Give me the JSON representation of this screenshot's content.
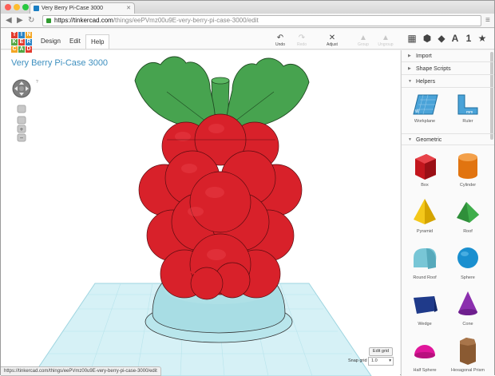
{
  "browser": {
    "tab_title": "Very Berry Pi-Case 3000",
    "url_host": "https://tinkercad.com",
    "url_path": "/things/eePVmz00u9E-very-berry-pi-case-3000/edit",
    "status_url": "https://tinkercad.com/things/eePVmz00u9E-very-berry-pi-case-3000/edit"
  },
  "logo": {
    "letters": [
      "T",
      "I",
      "N",
      "K",
      "E",
      "R",
      "C",
      "A",
      "D"
    ],
    "colors": [
      "#e23b2e",
      "#2a84c6",
      "#f4a623",
      "#55a845",
      "#e23b2e",
      "#2a84c6",
      "#f4a623",
      "#55a845",
      "#e23b2e"
    ]
  },
  "nav": {
    "design": "Design",
    "edit": "Edit",
    "help": "Help"
  },
  "tools": {
    "undo": "Undo",
    "redo": "Redo",
    "adjust": "Adjust",
    "group": "Group",
    "ungroup": "Ungroup"
  },
  "view_buttons": {
    "letter_a": "A",
    "number_one": "1"
  },
  "design_title": "Very Berry Pi-Case 3000",
  "canvas": {
    "edit_grid": "Edit grid",
    "snap_label": "Snap grid",
    "snap_value": "1.0"
  },
  "panel": {
    "sections": {
      "import": "Import",
      "shape_scripts": "Shape Scripts",
      "helpers": "Helpers",
      "geometric": "Geometric"
    },
    "helpers": [
      {
        "label": "Workplane",
        "mark": "W"
      },
      {
        "label": "Ruler",
        "mark": "mm"
      }
    ],
    "shapes": [
      "Box",
      "Cylinder",
      "Pyramid",
      "Roof",
      "Round Roof",
      "Sphere",
      "Wedge",
      "Cone",
      "Half Sphere",
      "Hexagonal Prism"
    ]
  },
  "colors": {
    "accent": "#3d8fbf",
    "berry": "#d8212a",
    "leaf": "#47a34f",
    "case": "#a8dde4",
    "grid": "#bfe9f1"
  }
}
